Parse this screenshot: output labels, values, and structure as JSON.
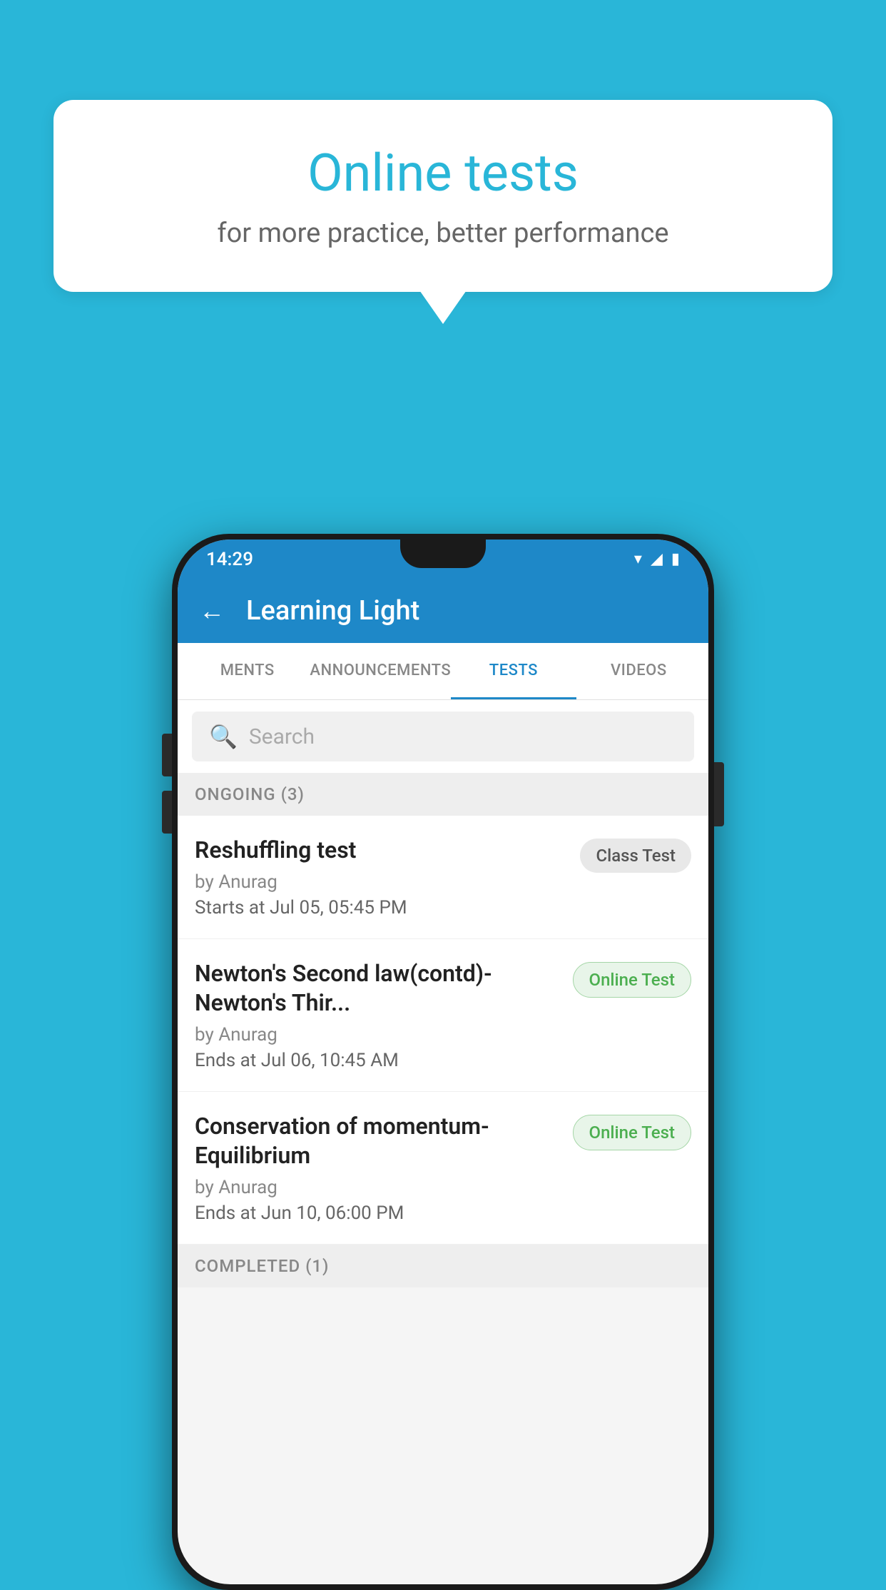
{
  "background": {
    "color": "#29b6d8"
  },
  "speech_bubble": {
    "title": "Online tests",
    "subtitle": "for more practice, better performance"
  },
  "phone": {
    "status_bar": {
      "time": "14:29",
      "icons": [
        "wifi",
        "signal",
        "battery"
      ]
    },
    "app_header": {
      "title": "Learning Light",
      "back_label": "←"
    },
    "tabs": [
      {
        "label": "MENTS",
        "active": false
      },
      {
        "label": "ANNOUNCEMENTS",
        "active": false
      },
      {
        "label": "TESTS",
        "active": true
      },
      {
        "label": "VIDEOS",
        "active": false
      }
    ],
    "search": {
      "placeholder": "Search"
    },
    "sections": [
      {
        "label": "ONGOING (3)",
        "tests": [
          {
            "name": "Reshuffling test",
            "author": "by Anurag",
            "date": "Starts at  Jul 05, 05:45 PM",
            "badge": "Class Test",
            "badge_type": "class"
          },
          {
            "name": "Newton's Second law(contd)-Newton's Thir...",
            "author": "by Anurag",
            "date": "Ends at  Jul 06, 10:45 AM",
            "badge": "Online Test",
            "badge_type": "online"
          },
          {
            "name": "Conservation of momentum-Equilibrium",
            "author": "by Anurag",
            "date": "Ends at  Jun 10, 06:00 PM",
            "badge": "Online Test",
            "badge_type": "online"
          }
        ]
      }
    ],
    "completed_section": {
      "label": "COMPLETED (1)"
    }
  }
}
